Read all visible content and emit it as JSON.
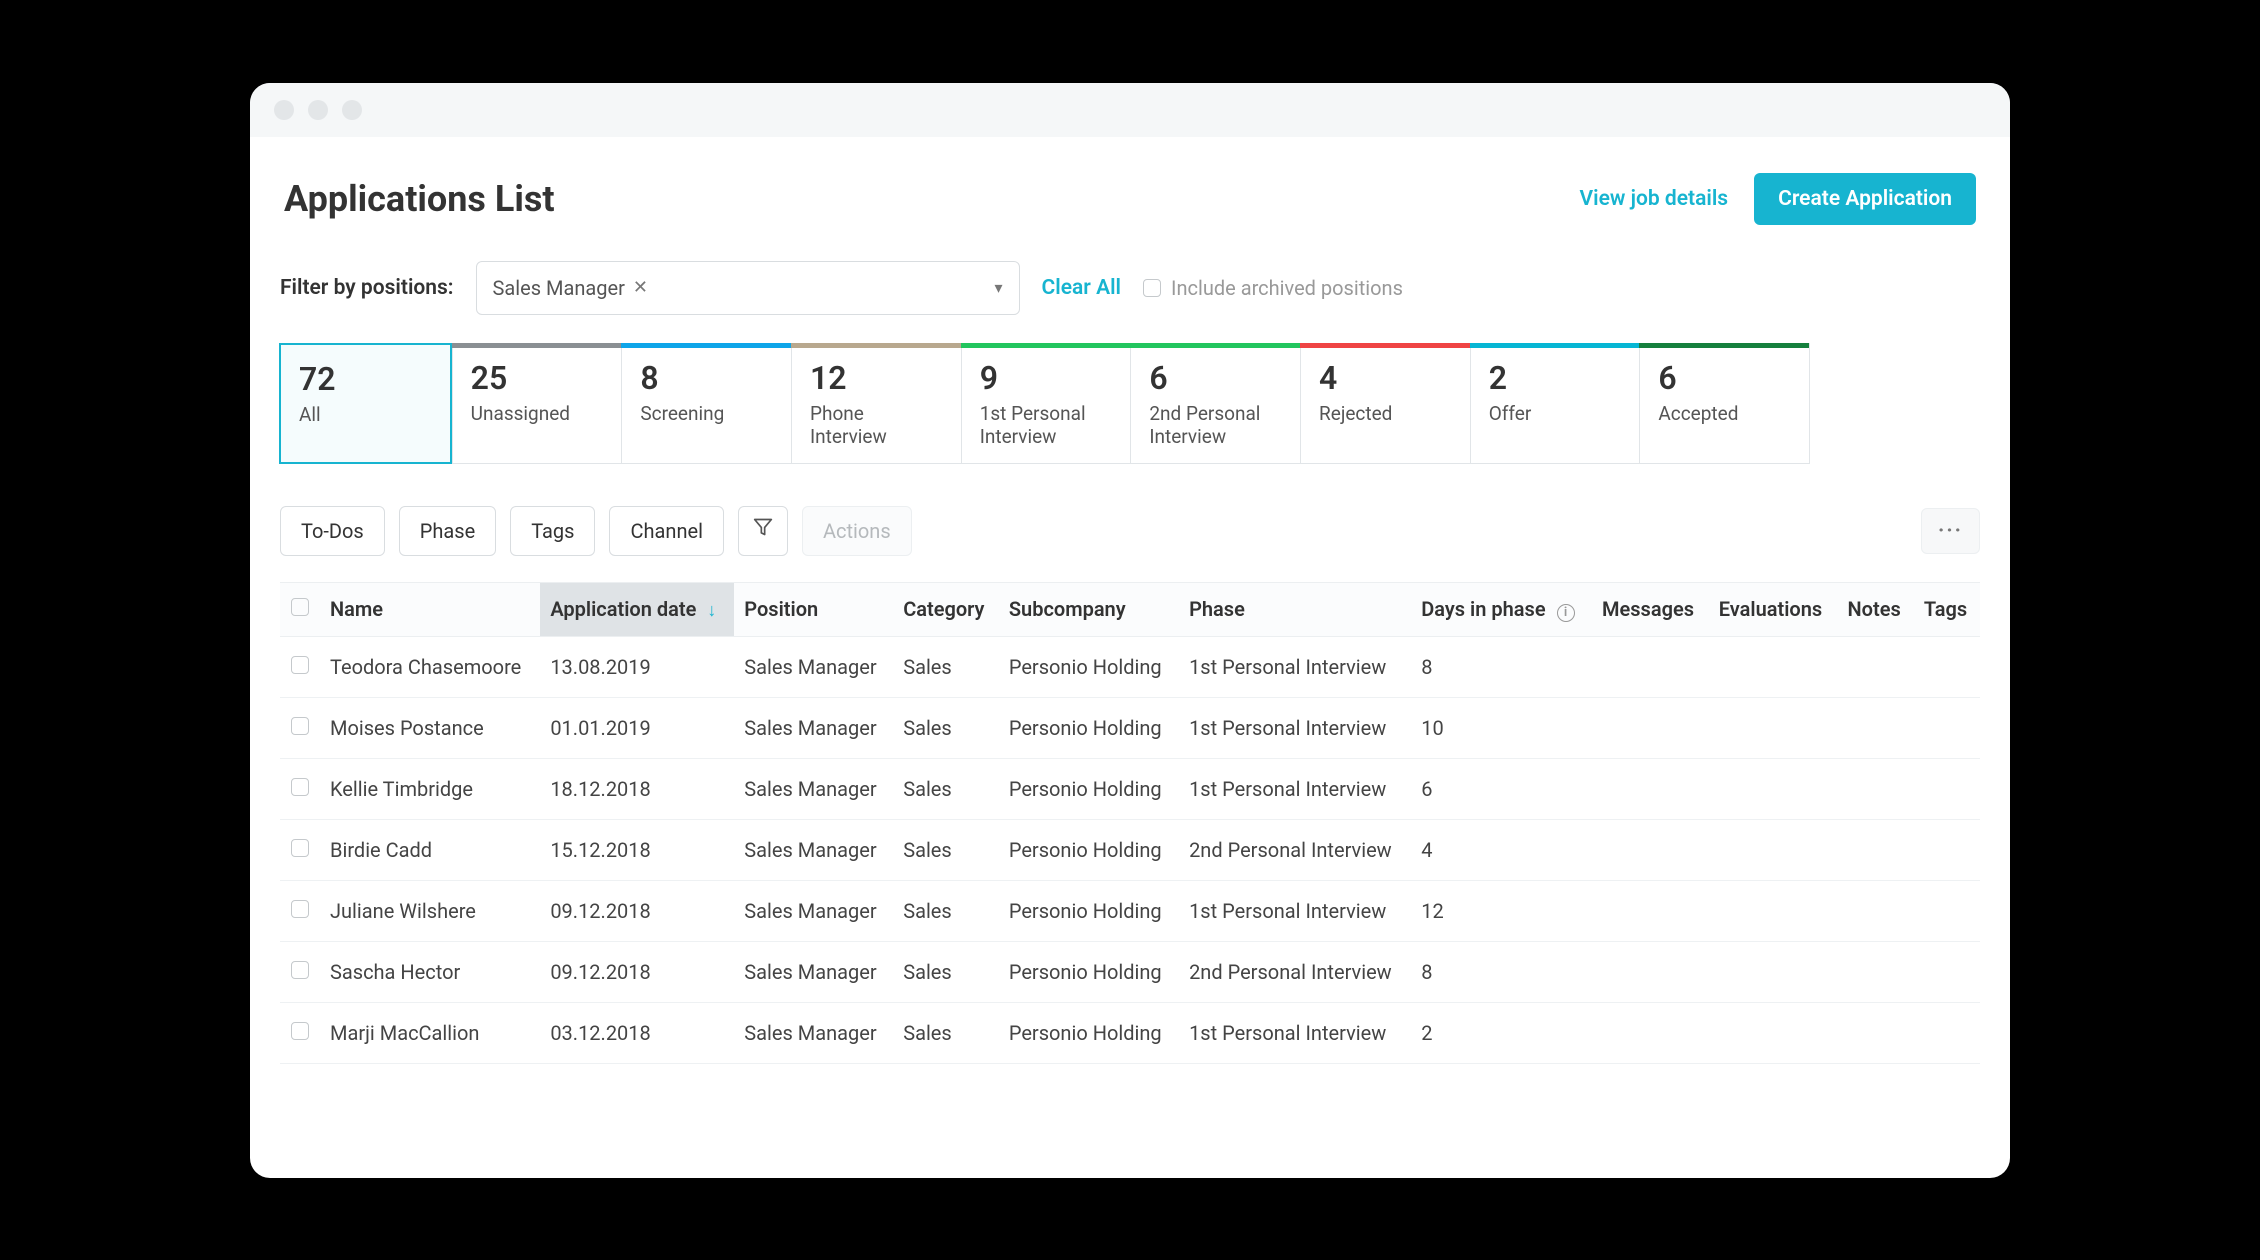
{
  "header": {
    "title": "Applications List",
    "view_job_label": "View job details",
    "create_app_label": "Create Application"
  },
  "filter": {
    "label": "Filter by positions:",
    "selected": "Sales Manager",
    "clear_all": "Clear All",
    "include_archived": "Include archived positions"
  },
  "stages": [
    {
      "count": "72",
      "label": "All",
      "bar": "active"
    },
    {
      "count": "25",
      "label": "Unassigned",
      "bar": "bar-gray"
    },
    {
      "count": "8",
      "label": "Screening",
      "bar": "bar-blue"
    },
    {
      "count": "12",
      "label": "Phone Interview",
      "bar": "bar-tan"
    },
    {
      "count": "9",
      "label": "1st Personal Interview",
      "bar": "bar-green"
    },
    {
      "count": "6",
      "label": "2nd Personal Interview",
      "bar": "bar-lime"
    },
    {
      "count": "4",
      "label": "Rejected",
      "bar": "bar-red"
    },
    {
      "count": "2",
      "label": "Offer",
      "bar": "bar-teal"
    },
    {
      "count": "6",
      "label": "Accepted",
      "bar": "bar-dkgreen"
    }
  ],
  "toolbar": {
    "todos": "To-Dos",
    "phase": "Phase",
    "tags": "Tags",
    "channel": "Channel",
    "actions": "Actions"
  },
  "columns": {
    "name": "Name",
    "app_date": "Application date",
    "position": "Position",
    "category": "Category",
    "subcompany": "Subcompany",
    "phase": "Phase",
    "days": "Days in phase",
    "messages": "Messages",
    "evaluations": "Evaluations",
    "notes": "Notes",
    "tags": "Tags"
  },
  "rows": [
    {
      "name": "Teodora Chasemoore",
      "date": "13.08.2019",
      "position": "Sales Manager",
      "category": "Sales",
      "subcompany": "Personio Holding",
      "phase": "1st Personal Interview",
      "days": "8"
    },
    {
      "name": "Moises Postance",
      "date": "01.01.2019",
      "position": "Sales Manager",
      "category": "Sales",
      "subcompany": "Personio Holding",
      "phase": "1st Personal Interview",
      "days": "10"
    },
    {
      "name": "Kellie Timbridge",
      "date": "18.12.2018",
      "position": "Sales Manager",
      "category": "Sales",
      "subcompany": "Personio Holding",
      "phase": "1st Personal Interview",
      "days": "6"
    },
    {
      "name": "Birdie Cadd",
      "date": "15.12.2018",
      "position": "Sales Manager",
      "category": "Sales",
      "subcompany": "Personio Holding",
      "phase": "2nd Personal Interview",
      "days": "4"
    },
    {
      "name": "Juliane Wilshere",
      "date": "09.12.2018",
      "position": "Sales Manager",
      "category": "Sales",
      "subcompany": "Personio Holding",
      "phase": "1st Personal Interview",
      "days": "12"
    },
    {
      "name": "Sascha Hector",
      "date": "09.12.2018",
      "position": "Sales Manager",
      "category": "Sales",
      "subcompany": "Personio Holding",
      "phase": "2nd Personal Interview",
      "days": "8"
    },
    {
      "name": "Marji MacCallion",
      "date": "03.12.2018",
      "position": "Sales Manager",
      "category": "Sales",
      "subcompany": "Personio Holding",
      "phase": "1st Personal Interview",
      "days": "2"
    }
  ]
}
